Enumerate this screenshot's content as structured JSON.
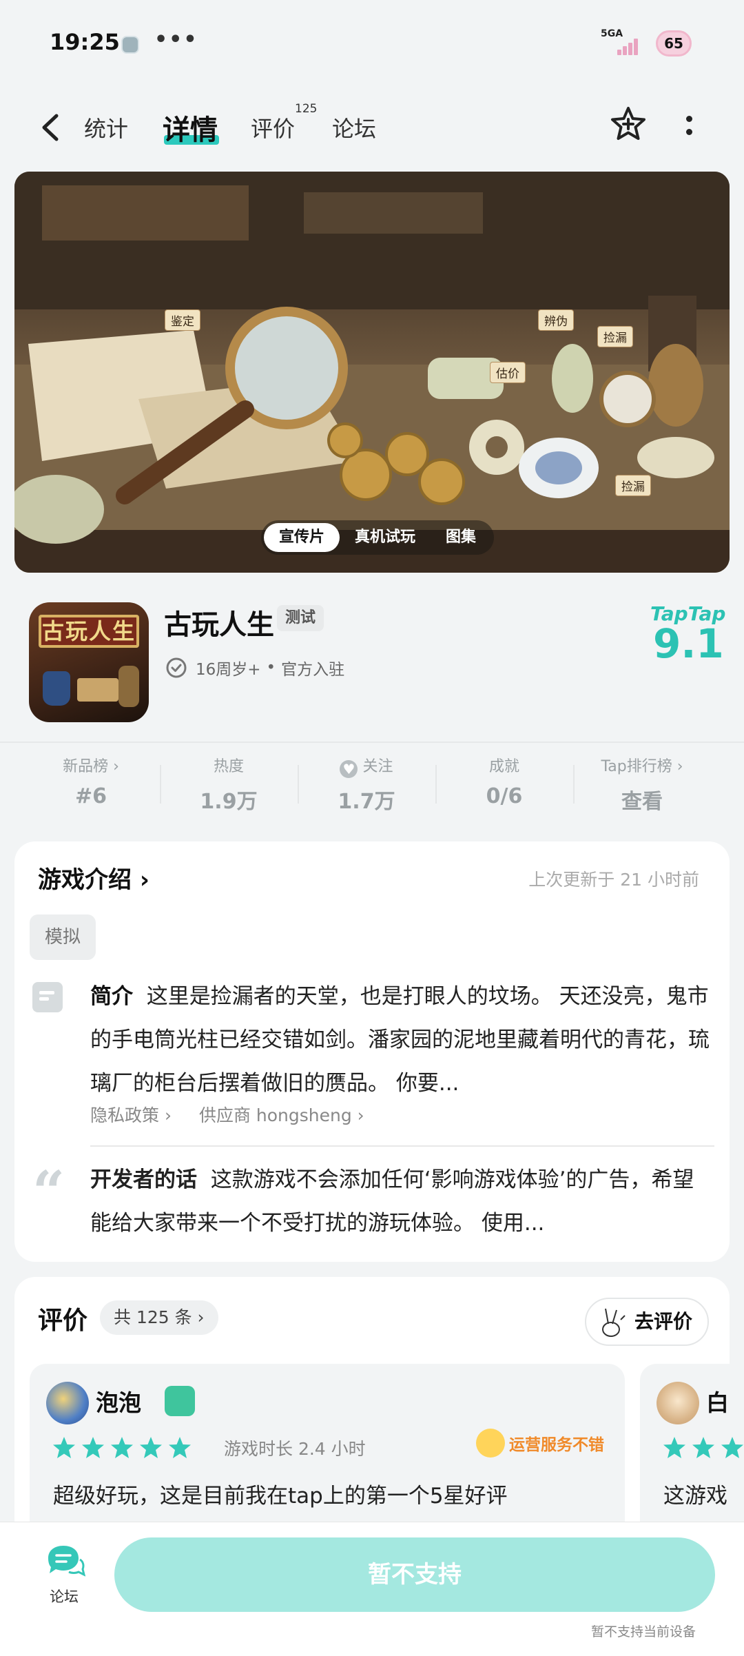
{
  "status_bar": {
    "time": "19:25",
    "dots": "•••",
    "network": "5GA",
    "battery": "65"
  },
  "nav": {
    "tabs": [
      {
        "label": "统计"
      },
      {
        "label": "详情",
        "active": true
      },
      {
        "label": "评价",
        "badge": "125"
      },
      {
        "label": "论坛"
      }
    ]
  },
  "banner": {
    "labels": [
      "鉴定",
      "辨伪",
      "捡漏",
      "估价",
      "捡漏"
    ],
    "media_tabs": [
      {
        "label": "宣传片",
        "active": true
      },
      {
        "label": "真机试玩"
      },
      {
        "label": "图集"
      }
    ]
  },
  "game": {
    "icon_text": "古玩人生",
    "title": "古玩人生",
    "tag": "测试",
    "age": "16周岁+",
    "separator": "•",
    "official": "官方入驻",
    "score_brand": "TapTap",
    "score": "9.1"
  },
  "stats": [
    {
      "label": "新品榜 ›",
      "value": "#6"
    },
    {
      "label": "热度",
      "value": "1.9万"
    },
    {
      "label": "关注",
      "value": "1.7万"
    },
    {
      "label": "成就",
      "value": "0/6"
    },
    {
      "label": "Tap排行榜 ›",
      "value": "查看"
    }
  ],
  "intro": {
    "title": "游戏介绍 ›",
    "updated": "上次更新于  21  小时前",
    "chip": "模拟",
    "summary_label": "简介",
    "summary": "这里是捡漏者的天堂，也是打眼人的坟场。 天还没亮，鬼市的手电筒光柱已经交错如剑。潘家园的泥地里藏着明代的青花，琉璃厂的柜台后摆着做旧的赝品。 你要...",
    "privacy_link": "隐私政策 ›",
    "vendor_link": "供应商  hongsheng ›",
    "dev_label": "开发者的话",
    "dev_text": "这款游戏不会添加任何‘影响游戏体验’的广告，希望能给大家带来一个不受打扰的游玩体验。 使用..."
  },
  "reviews": {
    "title": "评价",
    "count": "共  125  条 ›",
    "write_button": "去评价",
    "items": [
      {
        "name": "泡泡",
        "playtime": "游戏时长  2.4  小时",
        "tag": "运营服务不错",
        "rating": 5,
        "text": "超级好玩，这是目前我在tap上的第一个5星好评"
      },
      {
        "name": "白",
        "rating": 5,
        "text": "这游戏"
      }
    ]
  },
  "bottom": {
    "forum_label": "论坛",
    "main_button": "暂不支持",
    "note": "暂不支持当前设备"
  },
  "colors": {
    "accent": "#2cc9bd",
    "button_disabled": "#a4e8e0",
    "star": "#34c9b9"
  }
}
